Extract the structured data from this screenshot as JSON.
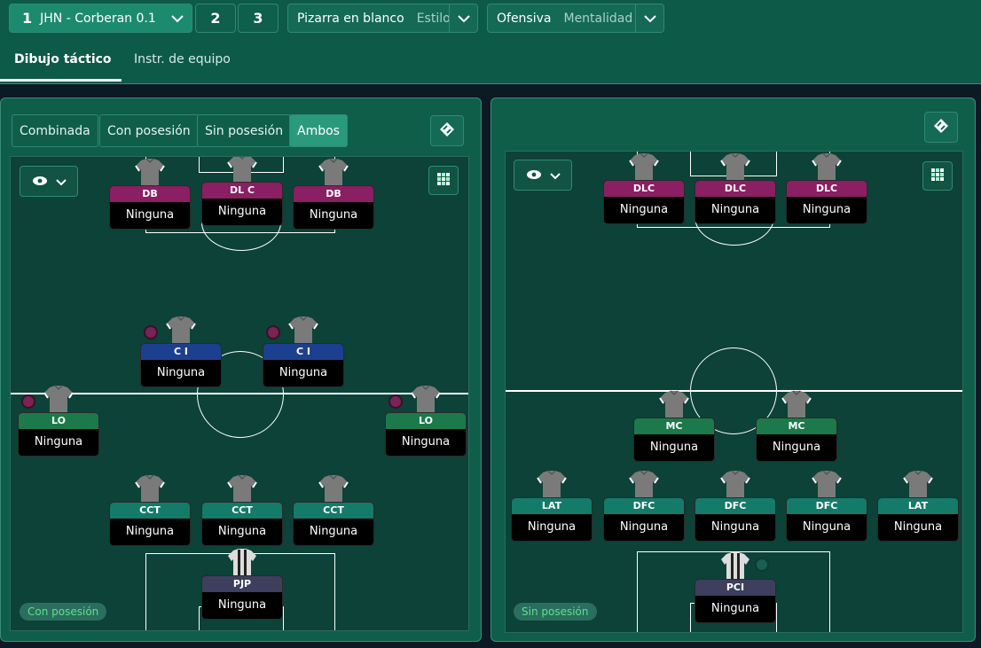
{
  "topbar": {
    "tactic_number": "1",
    "tactic_name": "JHN - Corberan 0.1",
    "tactic_slot_2": "2",
    "tactic_slot_3": "3",
    "style_value": "Pizarra en blanco",
    "style_label": "Estilo",
    "mentality_value": "Ofensiva",
    "mentality_label": "Mentalidad"
  },
  "tabs": {
    "formation": "Dibujo táctico",
    "team_instructions": "Instr. de equipo"
  },
  "left_panel": {
    "filters": [
      "Combinada",
      "Con posesión",
      "Sin posesión",
      "Ambos"
    ],
    "selected_filter": "Ambos",
    "phase_label": "Con posesión",
    "players": [
      {
        "role": "DB",
        "duty": "Ninguna"
      },
      {
        "role": "DL C",
        "duty": "Ninguna"
      },
      {
        "role": "DB",
        "duty": "Ninguna"
      },
      {
        "role": "C I",
        "duty": "Ninguna"
      },
      {
        "role": "C I",
        "duty": "Ninguna"
      },
      {
        "role": "LO",
        "duty": "Ninguna"
      },
      {
        "role": "LO",
        "duty": "Ninguna"
      },
      {
        "role": "CCT",
        "duty": "Ninguna"
      },
      {
        "role": "CCT",
        "duty": "Ninguna"
      },
      {
        "role": "CCT",
        "duty": "Ninguna"
      },
      {
        "role": "PJP",
        "duty": "Ninguna"
      }
    ]
  },
  "right_panel": {
    "phase_label": "Sin posesión",
    "players": [
      {
        "role": "DLC",
        "duty": "Ninguna"
      },
      {
        "role": "DLC",
        "duty": "Ninguna"
      },
      {
        "role": "DLC",
        "duty": "Ninguna"
      },
      {
        "role": "MC",
        "duty": "Ninguna"
      },
      {
        "role": "MC",
        "duty": "Ninguna"
      },
      {
        "role": "LAT",
        "duty": "Ninguna"
      },
      {
        "role": "DFC",
        "duty": "Ninguna"
      },
      {
        "role": "DFC",
        "duty": "Ninguna"
      },
      {
        "role": "DFC",
        "duty": "Ninguna"
      },
      {
        "role": "LAT",
        "duty": "Ninguna"
      },
      {
        "role": "PCI",
        "duty": "Ninguna"
      }
    ]
  },
  "colors": {
    "attack_role": "#8a1f63",
    "midfield_role": "#1d3f8f",
    "wide_role": "#1c7a4a",
    "defence_role": "#147a6a",
    "keeper_role": "#3e3f5e",
    "accent": "#2a9a7c"
  },
  "icons": [
    "chevron-down-icon",
    "eye-icon",
    "grid-icon",
    "pitch-swap-icon",
    "shirt-icon"
  ]
}
